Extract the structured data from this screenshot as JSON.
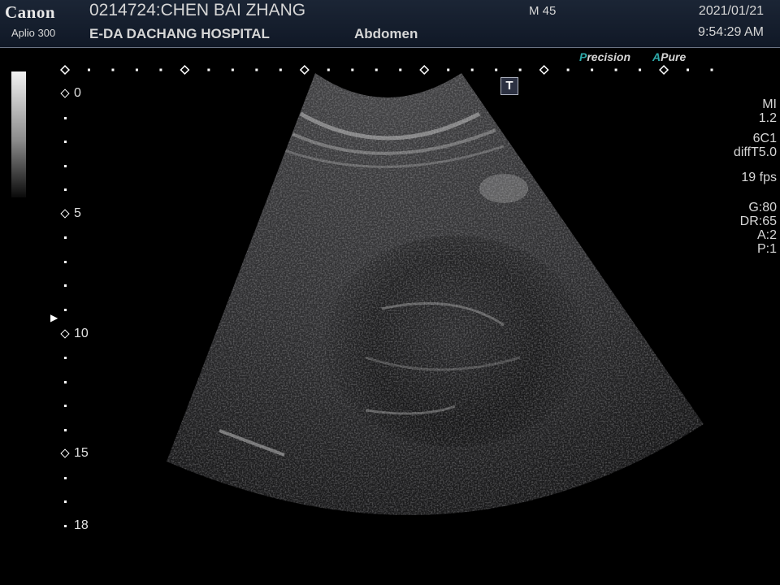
{
  "header": {
    "brand": "Canon",
    "model": "Aplio 300",
    "patient": "0214724:CHEN BAI ZHANG",
    "hospital": "E-DA DACHANG HOSPITAL",
    "exam": "Abdomen",
    "sex_age": "M 45",
    "date": "2021/01/21",
    "time": "9:54:29 AM"
  },
  "modes": {
    "precision_a": "P",
    "precision_b": "recision",
    "apure_a": "A",
    "apure_b": "Pure"
  },
  "t_marker": "T",
  "params": {
    "mi_label": "MI",
    "mi_value": "1.2",
    "probe": "6C1",
    "harmonic": "diffT5.0",
    "fps": "19 fps",
    "gain": "G:80",
    "dynamic_range": "DR:65",
    "a": "A:2",
    "p": "P:1"
  },
  "depth_scale": [
    "0",
    "5",
    "10",
    "15",
    "18"
  ],
  "focus_marker": "▶"
}
